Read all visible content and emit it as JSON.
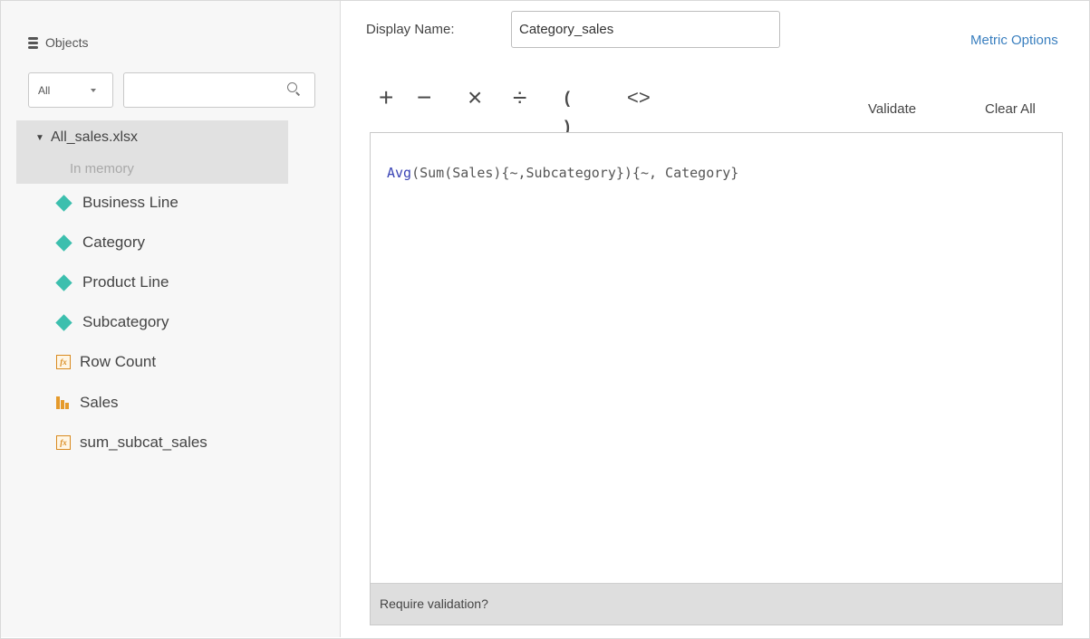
{
  "objects_panel": {
    "title": "Objects",
    "filter": {
      "selected": "All"
    },
    "search": {
      "value": "",
      "placeholder": ""
    },
    "dataset": {
      "name": "All_sales.xlsx",
      "status": "In memory"
    },
    "items": [
      {
        "label": "Business Line",
        "icon": "attribute-icon"
      },
      {
        "label": "Category",
        "icon": "attribute-icon"
      },
      {
        "label": "Product Line",
        "icon": "attribute-icon"
      },
      {
        "label": "Subcategory",
        "icon": "attribute-icon"
      },
      {
        "label": "Row Count",
        "icon": "derived-metric-icon"
      },
      {
        "label": "Sales",
        "icon": "metric-icon"
      },
      {
        "label": "sum_subcat_sales",
        "icon": "derived-metric-icon"
      }
    ]
  },
  "editor": {
    "display_name_label": "Display Name:",
    "display_name_value": "Category_sales",
    "metric_options": "Metric Options",
    "operators": [
      "+",
      "−",
      "×",
      "÷",
      "( )",
      "<>"
    ],
    "validate": "Validate",
    "clear_all": "Clear All",
    "formula_fn": "Avg",
    "formula_rest": "(Sum(Sales){~,Subcategory}){~, Category}",
    "status": "Require validation?"
  },
  "colors": {
    "attribute": "#3cbfae",
    "metric": "#e59a2b",
    "link": "#3a7fbf",
    "formula_function": "#3a44b5"
  }
}
